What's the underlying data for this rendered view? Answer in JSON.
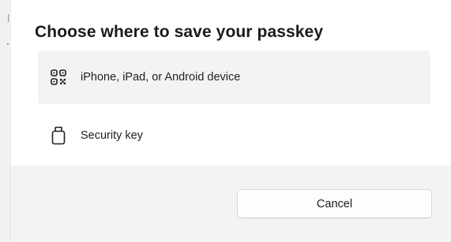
{
  "dialog": {
    "title": "Choose where to save your passkey",
    "options": [
      {
        "label": "iPhone, iPad, or Android device",
        "icon": "qr-code-icon",
        "selected": true
      },
      {
        "label": "Security key",
        "icon": "usb-security-key-icon",
        "selected": false
      }
    ],
    "cancel_label": "Cancel"
  },
  "colors": {
    "selected_background": "#f3f3f3",
    "footer_background": "#f3f3f3",
    "text": "#1b1b1b"
  }
}
